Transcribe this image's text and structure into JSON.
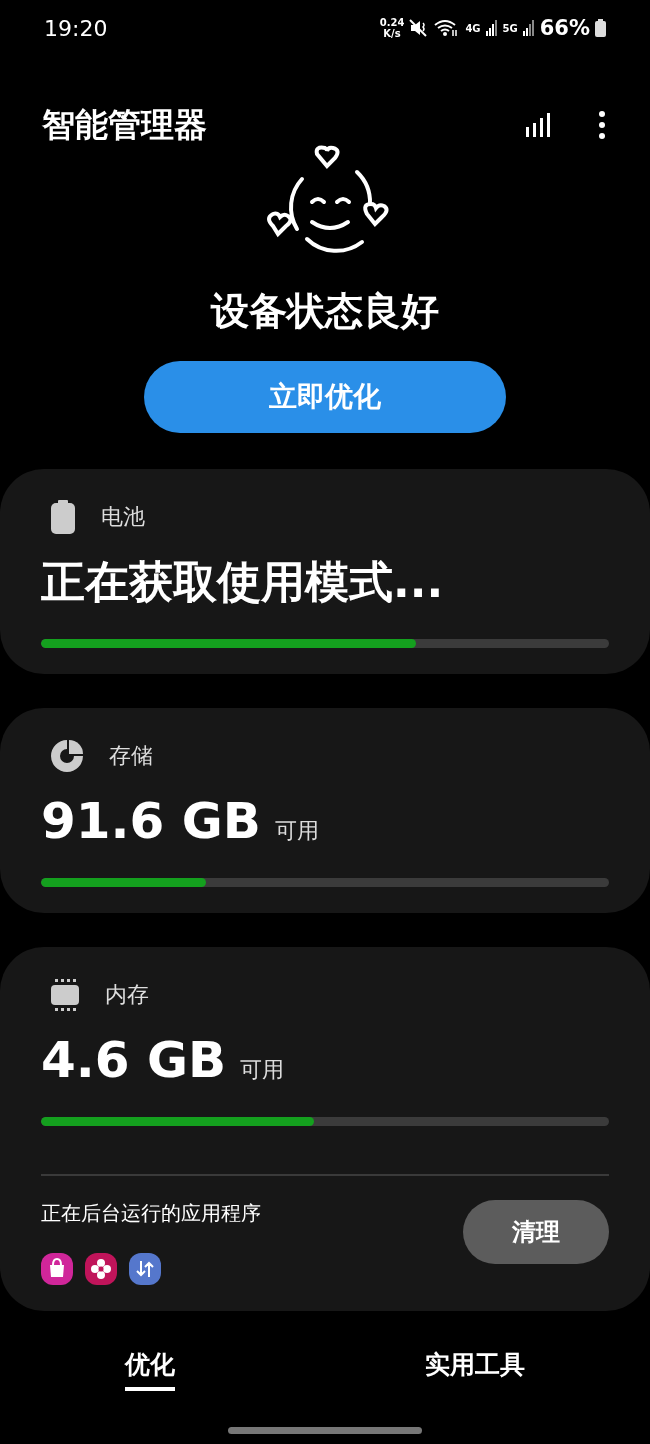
{
  "status_bar": {
    "time": "19:20",
    "net_speed_value": "0.24",
    "net_speed_unit": "K/s",
    "network_1": "4G",
    "network_2": "5G",
    "battery": "66%"
  },
  "header": {
    "title": "智能管理器"
  },
  "summary": {
    "status": "设备状态良好",
    "button": "立即优化"
  },
  "cards": [
    {
      "kind": "battery",
      "label": "电池",
      "value": "正在获取使用模式...",
      "level": 0.66
    },
    {
      "kind": "storage",
      "label": "存储",
      "value": "91.6 GB",
      "unit": "可用",
      "level": 0.29
    },
    {
      "kind": "memory",
      "label": "内存",
      "value": "4.6 GB",
      "unit": "可用",
      "level": 0.48,
      "background_apps": {
        "label": "正在后台运行的应用程序",
        "button": "清理"
      }
    }
  ],
  "tabs": [
    {
      "label": "优化",
      "selected": true
    },
    {
      "label": "实用工具",
      "selected": false
    }
  ]
}
